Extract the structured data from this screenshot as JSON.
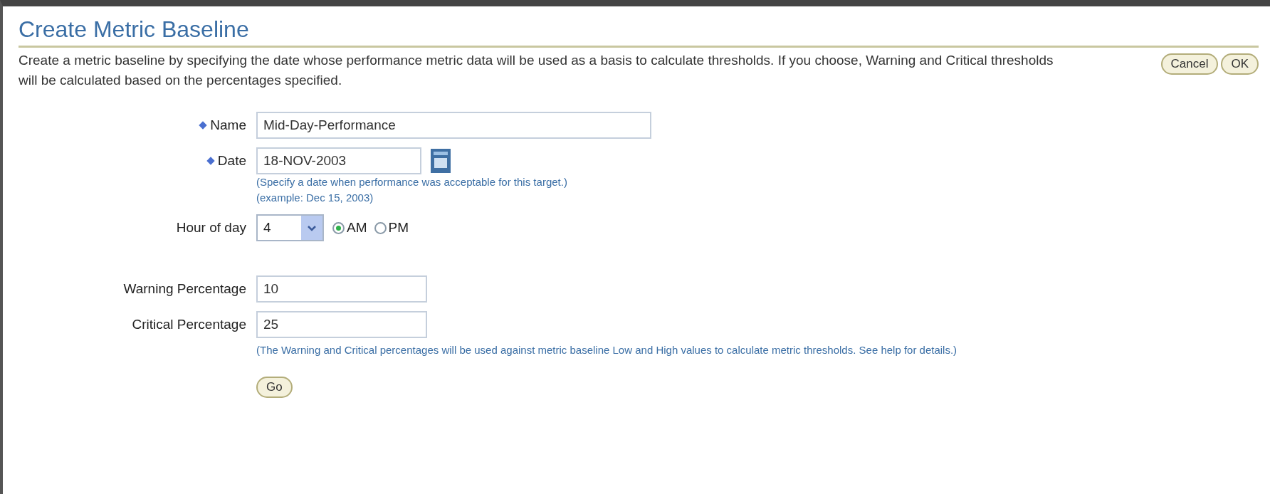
{
  "page": {
    "title": "Create Metric Baseline",
    "description": "Create a metric baseline by specifying the date whose performance metric data will be used as a basis to calculate thresholds. If you choose, Warning and Critical thresholds will be calculated based on the percentages specified.",
    "buttons": [
      {
        "label": "Cancel"
      },
      {
        "label": "OK"
      }
    ]
  },
  "form": {
    "name": {
      "label": "Name",
      "required": true,
      "value": "Mid-Day-Performance"
    },
    "date": {
      "label": "Date",
      "required": true,
      "value": "18-NOV-2003",
      "hint": "(Specify a date when performance was acceptable for this target.)",
      "example": "(example: Dec 15, 2003)"
    },
    "hour": {
      "label": "Hour of day",
      "value": "4",
      "options": [
        {
          "label": "AM",
          "selected": true
        },
        {
          "label": "PM",
          "selected": false
        }
      ]
    },
    "warning": {
      "label": "Warning Percentage",
      "value": "10"
    },
    "critical": {
      "label": "Critical Percentage",
      "value": "25"
    },
    "note": "(The Warning and Critical percentages will be used against metric baseline Low and High values to calculate metric thresholds. See help for details.)",
    "go_button": "Go"
  }
}
